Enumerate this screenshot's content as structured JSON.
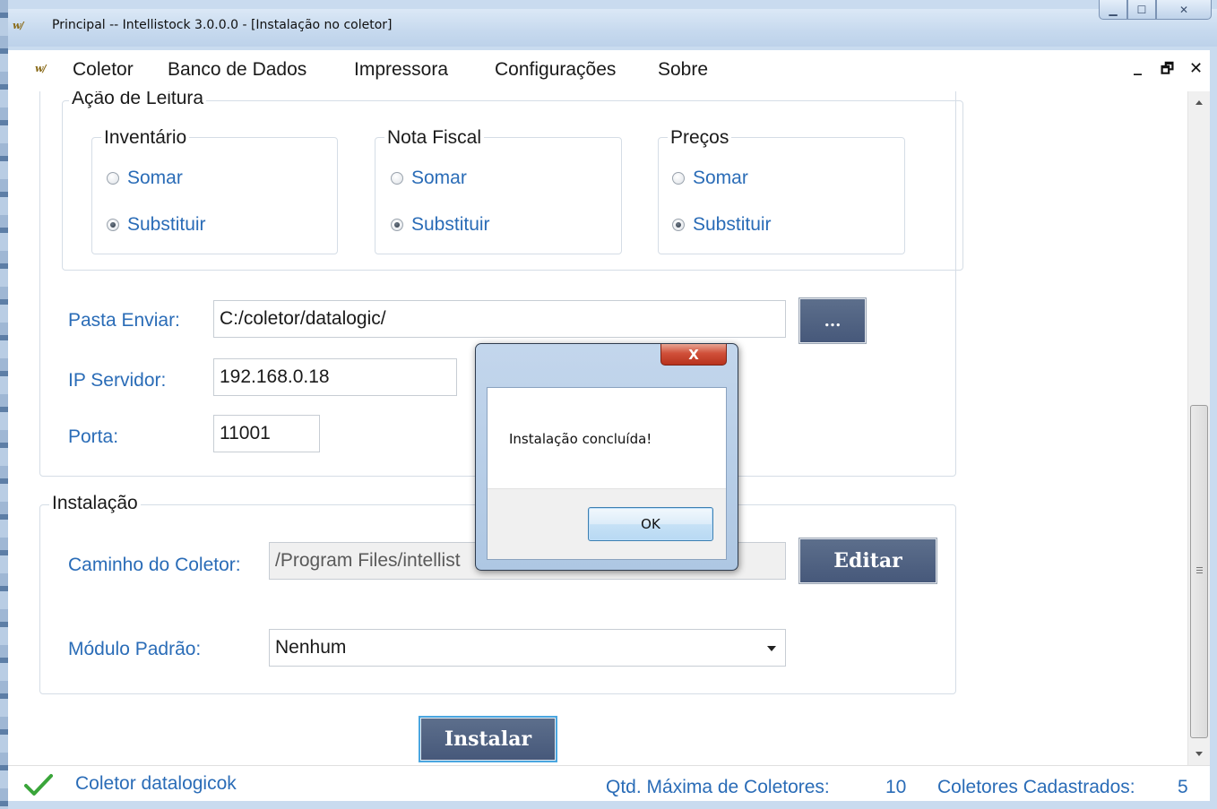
{
  "window": {
    "title": "Principal -- Intellistock 3.0.0.0 - [Instalação no coletor]",
    "logo_text": "w/"
  },
  "window_controls": {
    "minimize": "▁",
    "maximize": "☐",
    "close": "✕"
  },
  "menu": {
    "items": [
      {
        "label": "Coletor"
      },
      {
        "label": "Banco de Dados"
      },
      {
        "label": "Impressora"
      },
      {
        "label": "Configurações"
      },
      {
        "label": "Sobre"
      }
    ],
    "mdi_minimize": "_",
    "mdi_restore": "🗗",
    "mdi_close": "✕"
  },
  "acao_leitura": {
    "title": "Ação de Leitura",
    "groups": [
      {
        "title": "Inventário",
        "options": [
          {
            "label": "Somar",
            "checked": false
          },
          {
            "label": "Substituir",
            "checked": true
          }
        ]
      },
      {
        "title": "Nota Fiscal",
        "options": [
          {
            "label": "Somar",
            "checked": false
          },
          {
            "label": "Substituir",
            "checked": true
          }
        ]
      },
      {
        "title": "Preços",
        "options": [
          {
            "label": "Somar",
            "checked": false
          },
          {
            "label": "Substituir",
            "checked": true
          }
        ]
      }
    ]
  },
  "conexao": {
    "pasta_label": "Pasta Enviar:",
    "pasta_value": "C:/coletor/datalogic/",
    "browse_label": "...",
    "ip_label": "IP Servidor:",
    "ip_value": "192.168.0.18",
    "porta_label": "Porta:",
    "porta_value": "11001"
  },
  "instalacao": {
    "title": "Instalação",
    "caminho_label": "Caminho do Coletor:",
    "caminho_value": "/Program Files/intellist",
    "editar_label": "Editar",
    "modulo_label": "Módulo Padrão:",
    "modulo_value": "Nenhum"
  },
  "instalar_label": "Instalar",
  "status": {
    "message": "Coletor datalogicok",
    "qtd_max_label": "Qtd. Máxima de Coletores:",
    "qtd_max_value": "10",
    "cadastrados_label": "Coletores Cadastrados:",
    "cadastrados_value": "5"
  },
  "dialog": {
    "close_glyph": "X",
    "message": "Instalação concluída!",
    "ok_label": "OK"
  },
  "colors": {
    "label_blue": "#2a6cb7",
    "button_dark": "#4f6282",
    "check_green": "#3aa53a"
  }
}
